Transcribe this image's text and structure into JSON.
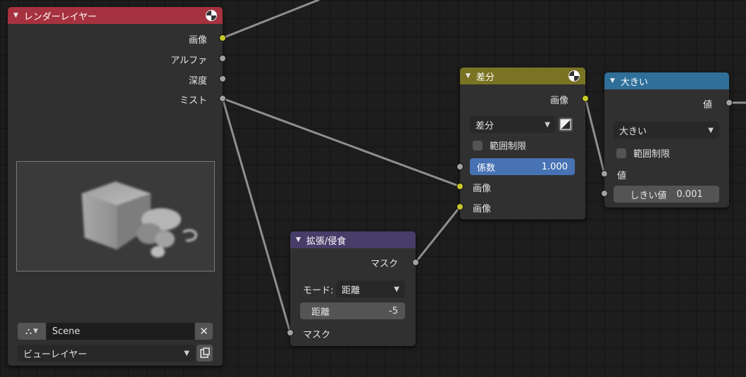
{
  "colors": {
    "render_layer_header": "#a7323f",
    "mix_header": "#7a7323",
    "math_header": "#2f6f99",
    "filter_header": "#473d69",
    "socket_color": "#c7c729",
    "socket_value": "#a1a1a1",
    "slider_blue": "#4772b3"
  },
  "render_layers": {
    "title": "レンダーレイヤー",
    "outputs": [
      "画像",
      "アルファ",
      "深度",
      "ミスト"
    ],
    "scene": "Scene",
    "view_layer": "ビューレイヤー",
    "icons": {
      "collapse": "triangle-down-icon",
      "preview": "preview-sphere-icon",
      "scene": "scene-icon",
      "clear": "close-icon",
      "view_layer": "render-layer-icon"
    }
  },
  "mix_node": {
    "title": "差分",
    "output": "画像",
    "blend_mode": "差分",
    "clamp_label": "範囲制限",
    "factor_label": "係数",
    "factor_value": "1.000",
    "inputs": [
      "画像",
      "画像"
    ]
  },
  "math_node": {
    "title": "大きい",
    "output": "値",
    "operation": "大きい",
    "clamp_label": "範囲制限",
    "input_label": "値",
    "threshold_label": "しきい値",
    "threshold_value": "0.001"
  },
  "dilate_node": {
    "title": "拡張/侵食",
    "output": "マスク",
    "mode_label": "モード:",
    "mode_value": "距離",
    "distance_label": "距離",
    "distance_value": "-5",
    "input": "マスク"
  }
}
